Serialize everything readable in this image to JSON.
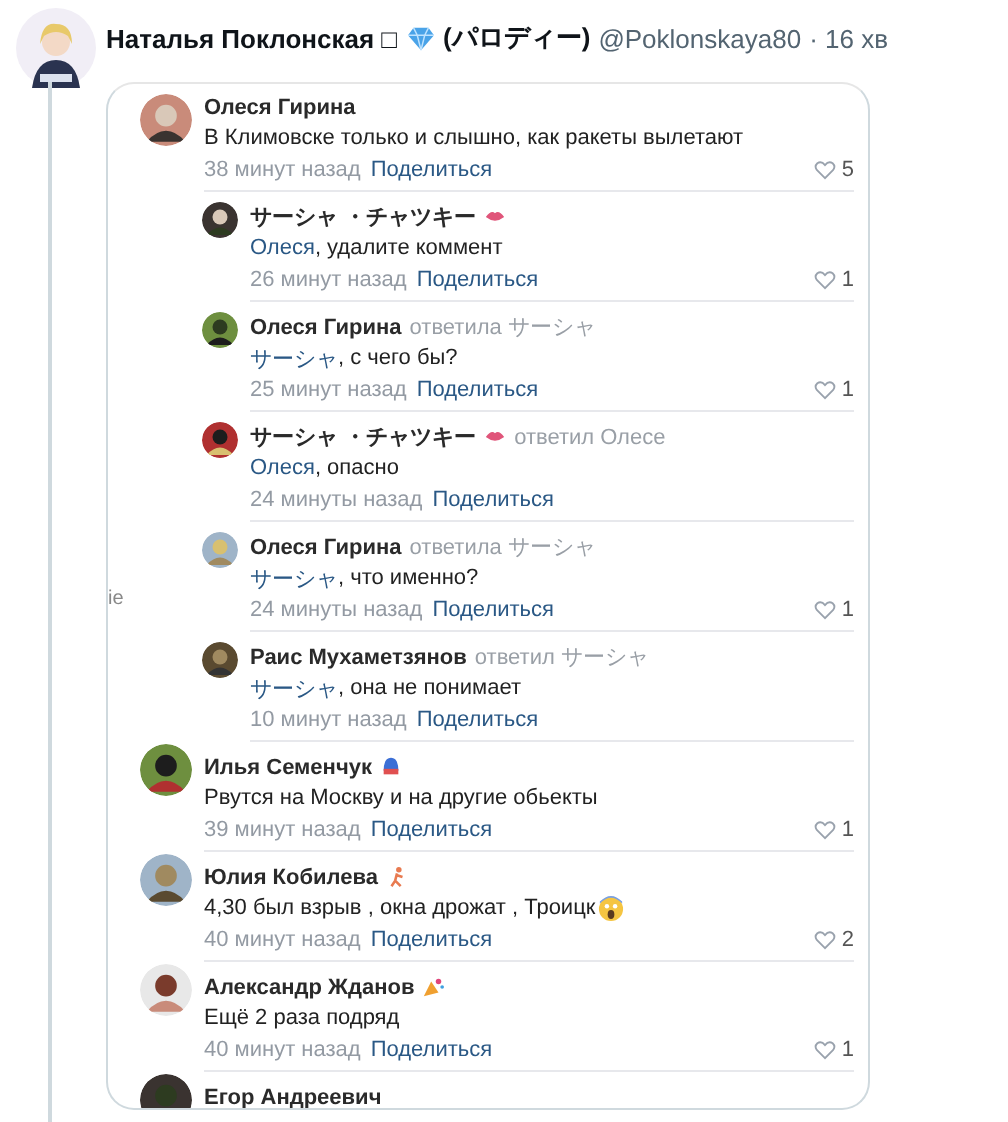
{
  "tweet": {
    "author_name": "Наталья Поклонская □",
    "author_suffix": "(パロディー)",
    "handle": "@Poklonskaya80",
    "time": "· 16 хв"
  },
  "side_fragment": "ie",
  "comments": [
    {
      "name": "Олеся Гирина",
      "text": "В Климовске только и слышно, как ракеты вылетают",
      "time": "38 минут назад",
      "share": "Поделиться",
      "likes": "5",
      "children": [
        {
          "name": "サーシャ ・チャツキー",
          "badge": {
            "kind": "lips"
          },
          "mention": "Олеся",
          "text": ", удалите коммент",
          "time": "26 минут назад",
          "share": "Поделиться",
          "likes": "1"
        },
        {
          "name": "Олеся Гирина",
          "reply_to": "ответила サーシャ",
          "mention": "サーシャ",
          "text": ", с чего бы?",
          "time": "25 минут назад",
          "share": "Поделиться",
          "likes": "1"
        },
        {
          "name": "サーシャ ・チャツキー",
          "badge": {
            "kind": "lips"
          },
          "reply_to": "ответил Олесе",
          "mention": "Олеся",
          "text": ", опасно",
          "time": "24 минуты назад",
          "share": "Поделиться"
        },
        {
          "name": "Олеся Гирина",
          "reply_to": "ответила サーシャ",
          "mention": "サーシャ",
          "text": ", что именно?",
          "time": "24 минуты назад",
          "share": "Поделиться",
          "likes": "1"
        },
        {
          "name": "Раис Мухаметзянов",
          "reply_to": "ответил サーシャ",
          "mention": "サーシャ",
          "text": ", она не понимает",
          "time": "10 минут назад",
          "share": "Поделиться"
        }
      ]
    },
    {
      "name": "Илья Семенчук",
      "badge": {
        "kind": "helmet"
      },
      "text": "Рвутся на Москву и на другие обьекты",
      "time": "39 минут назад",
      "share": "Поделиться",
      "likes": "1"
    },
    {
      "name": "Юлия Кобилева",
      "badge": {
        "kind": "runner"
      },
      "text": "4,30 был взрыв , окна дрожат , Троицк",
      "text_emoji": {
        "kind": "scream"
      },
      "time": "40 минут назад",
      "share": "Поделиться",
      "likes": "2"
    },
    {
      "name": "Александр Жданов",
      "badge": {
        "kind": "party"
      },
      "text": "Ещё 2 раза подряд",
      "time": "40 минут назад",
      "share": "Поделиться",
      "likes": "1"
    },
    {
      "name": "Егор Андреевич"
    }
  ]
}
